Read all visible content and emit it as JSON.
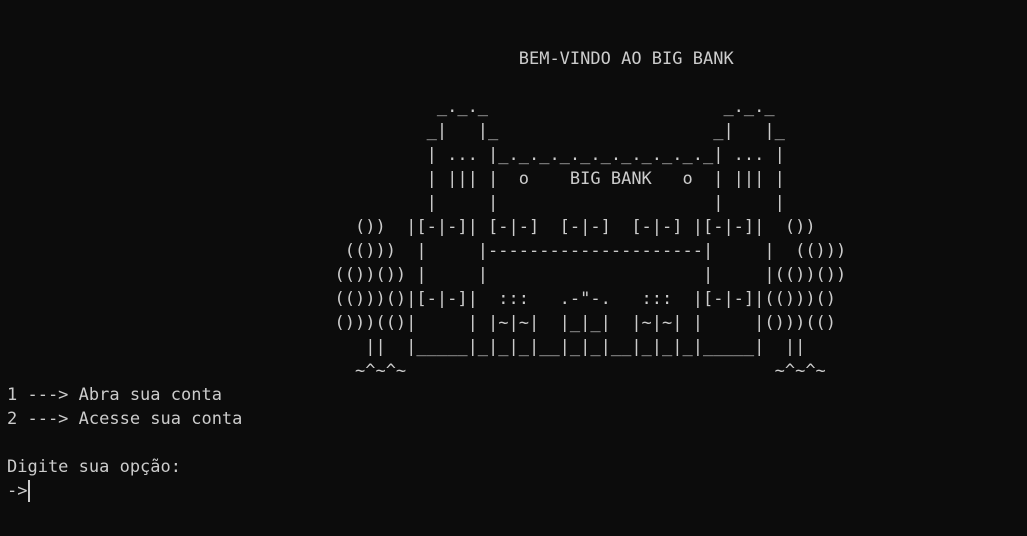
{
  "terminal": {
    "banner": {
      "title_line": "                                                  BEM-VINDO AO BIG BANK",
      "art": [
        "                                          _._._                       _._._",
        "                                         _|   |_                     _|   |_",
        "                                         | ... |_._._._._._._._._._._| ... |",
        "                                         | ||| |  o    BIG BANK   o  | ||| |",
        "                                         |     |                     |     |",
        "                                  ())  |[-|-]| [-|-]  [-|-]  [-|-] |[-|-]|  ())",
        "                                 (()))  |     |---------------------|     |  (()))",
        "                                (())()) |     |                     |     |(())())",
        "                                (()))()|[-|-]|  :::   .-\"-.   :::  |[-|-]|(()))()",
        "                                ()))(()|     | |~|~|  |_|_|  |~|~| |     |()))(()",
        "                                   ||  |_____|_|_|_|__|_|_|__|_|_|_|_____|  ||",
        "                                  ~^~^~                                    ~^~^~"
      ]
    },
    "menu": {
      "option1": "1 ---> Abra sua conta",
      "option2": "2 ---> Acesse sua conta"
    },
    "prompt": {
      "label": "Digite sua opção:",
      "input_prefix": "->"
    }
  }
}
